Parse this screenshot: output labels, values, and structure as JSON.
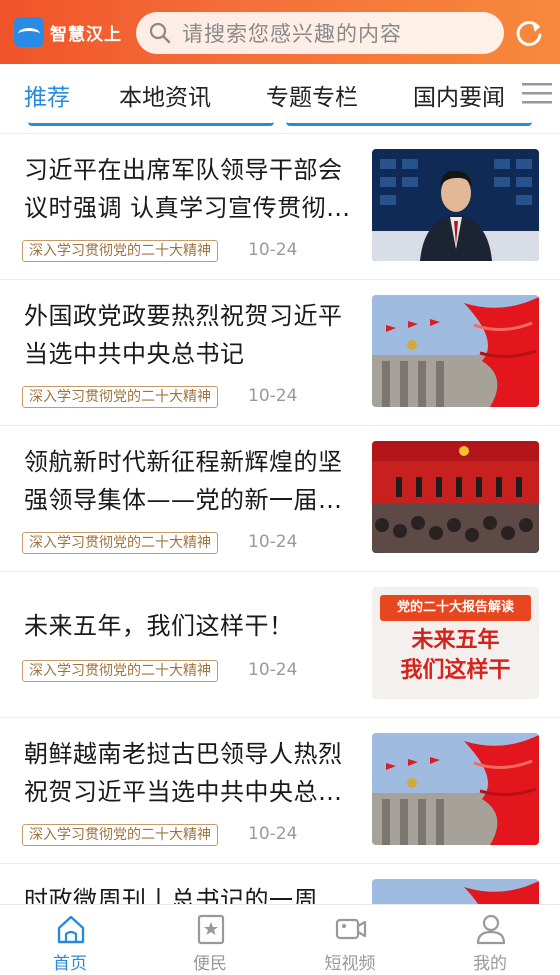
{
  "header": {
    "logo_text": "智慧汉上",
    "search_placeholder": "请搜索您感兴趣的内容"
  },
  "tabs": [
    {
      "label": "推荐",
      "active": true
    },
    {
      "label": "本地资讯",
      "active": false
    },
    {
      "label": "专题专栏",
      "active": false
    },
    {
      "label": "国内要闻",
      "active": false
    }
  ],
  "feed": {
    "items": [
      {
        "title": "习近平在出席军队领导干部会议时强调 认真学习宣传贯彻党的二十大精神",
        "tag": "深入学习贯彻党的二十大精神",
        "date": "10-24",
        "thumb": "news-anchor"
      },
      {
        "title": "外国政党政要热烈祝贺习近平当选中共中央总书记",
        "tag": "深入学习贯彻党的二十大精神",
        "date": "10-24",
        "thumb": "flags-hall"
      },
      {
        "title": "领航新时代新征程新辉煌的坚强领导集体——党的新一届中央领导机构产生纪实",
        "tag": "深入学习贯彻党的二十大精神",
        "date": "10-24",
        "thumb": "press-meeting"
      },
      {
        "title": "未来五年，我们这样干！",
        "tag": "深入学习贯彻党的二十大精神",
        "date": "10-24",
        "thumb": "report-card"
      },
      {
        "title": "朝鲜越南老挝古巴领导人热烈祝贺习近平当选中共中央总书记",
        "tag": "深入学习贯彻党的二十大精神",
        "date": "10-24",
        "thumb": "flags-hall"
      },
      {
        "title": "时政微周刊丨总书记的一周",
        "tag": "",
        "date": "",
        "thumb": "flags-hall"
      }
    ],
    "report_card": {
      "banner": "党的二十大报告解读",
      "line1": "未来五年",
      "line2": "我们这样干"
    }
  },
  "bottom_nav": [
    {
      "label": "首页",
      "icon": "home-icon",
      "active": true
    },
    {
      "label": "便民",
      "icon": "star-bookmark-icon",
      "active": false
    },
    {
      "label": "短视频",
      "icon": "video-camera-icon",
      "active": false
    },
    {
      "label": "我的",
      "icon": "user-icon",
      "active": false
    }
  ],
  "colors": {
    "header": "#f0542a",
    "accent": "#2b8ad8",
    "tag": "#a0723e"
  }
}
